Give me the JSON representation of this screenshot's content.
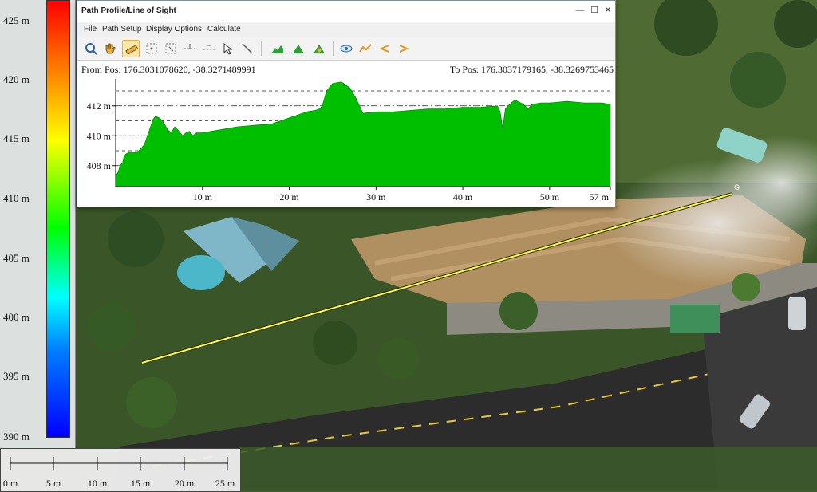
{
  "app": {
    "window_title": "Path Profile/Line of Sight",
    "title_buttons": {
      "minimize": "—",
      "maximize": "☐",
      "close": "✕"
    }
  },
  "menu": [
    {
      "label": "File"
    },
    {
      "label": "Path Setup"
    },
    {
      "label": "Display Options"
    },
    {
      "label": "Calculate"
    }
  ],
  "toolbar": {
    "tools": [
      {
        "icon": "zoom-in-icon"
      },
      {
        "icon": "pan-hand-icon"
      },
      {
        "icon": "measure-ruler-icon",
        "active": true
      },
      {
        "icon": "select-points-icon"
      },
      {
        "icon": "select-area-icon"
      },
      {
        "icon": "add-point-icon"
      },
      {
        "icon": "move-point-icon"
      },
      {
        "icon": "pointer-icon"
      },
      {
        "icon": "draw-line-icon"
      },
      {
        "icon": "profile-elevation-icon"
      },
      {
        "icon": "terrain-icon"
      },
      {
        "icon": "terrain-warning-icon"
      },
      {
        "icon": "view-shed-icon"
      },
      {
        "icon": "line-of-sight-icon"
      },
      {
        "icon": "step-back-icon"
      },
      {
        "icon": "step-forward-icon"
      }
    ]
  },
  "path": {
    "from_label": "From Pos: 176.3031078620, -38.3271489991",
    "to_label": "To Pos: 176.3037179165, -38.3269753465"
  },
  "chart_data": {
    "type": "area",
    "title": "",
    "xlabel": "",
    "ylabel": "",
    "xlim": [
      0,
      57
    ],
    "ylim": [
      406.6,
      413.8
    ],
    "x_ticks": [
      10,
      20,
      30,
      40,
      50,
      57
    ],
    "x_tick_labels": [
      "10 m",
      "20 m",
      "30 m",
      "40 m",
      "50 m",
      "57 m"
    ],
    "y_ticks": [
      408,
      410,
      412
    ],
    "y_tick_labels": [
      "408 m",
      "410 m",
      "412 m"
    ],
    "grid": true,
    "fill_color": "#00bf00",
    "x": [
      0,
      0.3,
      0.5,
      0.8,
      1.0,
      1.5,
      2.5,
      3.3,
      4.3,
      4.6,
      5.0,
      5.4,
      6.0,
      6.4,
      6.8,
      7.3,
      7.7,
      8.1,
      8.5,
      8.9,
      9.3,
      10,
      12,
      14,
      16,
      18,
      19,
      20,
      21,
      21.5,
      22,
      23,
      23.5,
      23.8,
      24.3,
      25,
      26,
      27,
      27.7,
      28.5,
      30,
      32,
      34,
      36,
      38,
      40,
      42,
      44,
      44.3,
      44.6,
      44.9,
      45.2,
      45.4,
      46,
      47,
      47.5,
      48,
      49,
      50,
      52,
      54,
      56,
      57
    ],
    "y": [
      407.3,
      407.6,
      408.0,
      408.2,
      408.7,
      408.9,
      408.9,
      409.4,
      411.1,
      411.3,
      411.2,
      411.0,
      410.4,
      410.2,
      410.6,
      410.3,
      410.0,
      410.2,
      410.3,
      410.0,
      410.2,
      410.2,
      410.4,
      410.6,
      410.7,
      410.8,
      411.0,
      411.2,
      411.4,
      411.5,
      411.6,
      411.7,
      411.8,
      412.0,
      413.0,
      413.5,
      413.6,
      413.2,
      412.5,
      411.5,
      411.6,
      411.6,
      411.7,
      411.8,
      411.8,
      411.9,
      411.9,
      412.0,
      411.6,
      410.5,
      411.8,
      412.0,
      412.1,
      412.4,
      412.1,
      411.8,
      412.1,
      412.2,
      412.2,
      412.3,
      412.2,
      412.2,
      412.1
    ]
  },
  "legend": {
    "gradient_top": "#ff0000",
    "gradient_bottom": "#0000ff",
    "labels": [
      "425 m",
      "420 m",
      "415 m",
      "410 m",
      "405 m",
      "400 m",
      "395 m",
      "390 m"
    ]
  },
  "scalebar": {
    "labels": [
      "0 m",
      "5 m",
      "10 m",
      "15 m",
      "20 m",
      "25 m"
    ]
  },
  "map": {
    "path_marker": "G",
    "path_color": "#ffff33"
  }
}
